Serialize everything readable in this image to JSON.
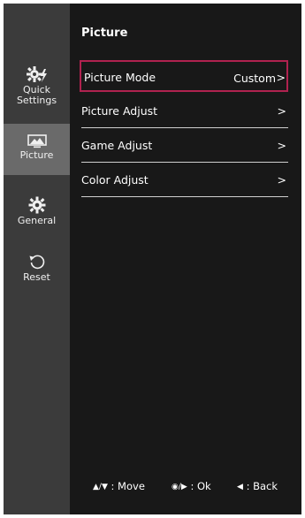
{
  "header": {
    "title": "Picture"
  },
  "sidebar": {
    "items": [
      {
        "label_line1": "Quick",
        "label_line2": "Settings",
        "icon": "quick-settings-gear-icon",
        "active": false
      },
      {
        "label": "Picture",
        "icon": "picture-icon",
        "active": true
      },
      {
        "label": "General",
        "icon": "gear-icon",
        "active": false
      },
      {
        "label": "Reset",
        "icon": "reset-icon",
        "active": false
      }
    ]
  },
  "menu": {
    "items": [
      {
        "label": "Picture Mode",
        "value": "Custom",
        "chevron": ">",
        "selected": true
      },
      {
        "label": "Picture Adjust",
        "chevron": ">"
      },
      {
        "label": "Game Adjust",
        "chevron": ">"
      },
      {
        "label": "Color Adjust",
        "chevron": ">"
      }
    ]
  },
  "footer": {
    "move": {
      "glyphs": "▲/▼",
      "label": ": Move"
    },
    "ok": {
      "glyphs": "◉/▶",
      "label": ": Ok"
    },
    "back": {
      "glyphs": "◀",
      "label": ": Back"
    }
  },
  "colors": {
    "background": "#181818",
    "sidebar": "#3b3b3b",
    "sidebar_active": "#6a6a6a",
    "selection_border": "#b0224f",
    "text": "#ffffff"
  }
}
